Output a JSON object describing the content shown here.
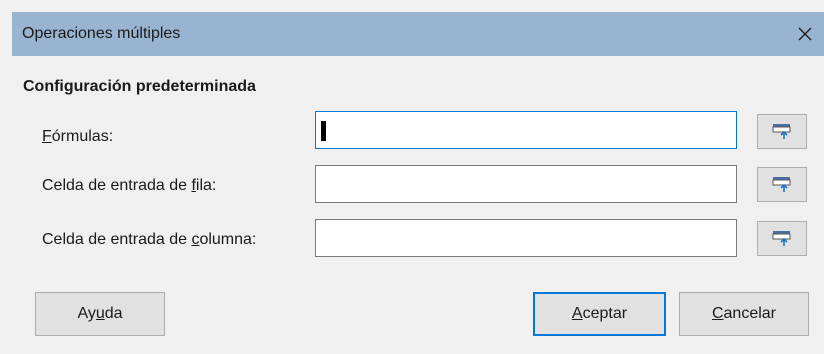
{
  "dialog": {
    "title": "Operaciones múltiples",
    "close_glyph": "✕"
  },
  "section": {
    "title": "Configuración predeterminada"
  },
  "rows": [
    {
      "label_pre": "",
      "label_key": "F",
      "label_post": "órmulas:",
      "value": ""
    },
    {
      "label_pre": "Celda de entrada de ",
      "label_key": "f",
      "label_post": "ila:",
      "value": ""
    },
    {
      "label_pre": "Celda de entrada de ",
      "label_key": "c",
      "label_post": "olumna:",
      "value": ""
    }
  ],
  "buttons": {
    "help": {
      "pre": "Ay",
      "key": "u",
      "post": "da"
    },
    "ok": {
      "pre": "",
      "key": "A",
      "post": "ceptar"
    },
    "cancel": {
      "pre": "",
      "key": "C",
      "post": "ancelar"
    }
  },
  "icons": {
    "close": "close-icon",
    "shrink": "shrink-dialog-icon"
  },
  "colors": {
    "titlebar": "#99b4d1",
    "focus": "#0078d7",
    "button_face": "#e1e1e1"
  }
}
